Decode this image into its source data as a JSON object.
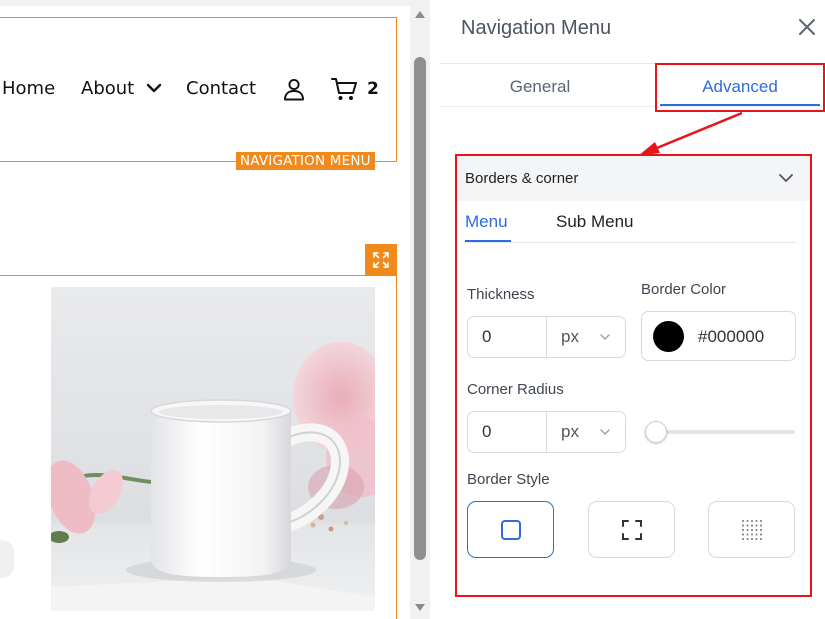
{
  "canvas": {
    "nav": {
      "items": [
        "Home",
        "About",
        "Contact"
      ],
      "cart_count": "2",
      "badge": "NAVIGATION MENU"
    },
    "icons": [
      "chevron-down-icon",
      "user-icon",
      "cart-icon",
      "expand-icon"
    ]
  },
  "panel": {
    "title": "Navigation Menu",
    "tabs": [
      {
        "label": "General",
        "active": false
      },
      {
        "label": "Advanced",
        "active": true
      }
    ],
    "section": {
      "title": "Borders & corner",
      "subtabs": [
        {
          "label": "Menu",
          "active": true
        },
        {
          "label": "Sub Menu",
          "active": false
        }
      ],
      "thickness": {
        "label": "Thickness",
        "value": "0",
        "unit": "px"
      },
      "border_color": {
        "label": "Border Color",
        "value": "#000000"
      },
      "corner_radius": {
        "label": "Corner Radius",
        "value": "0",
        "unit": "px",
        "slider_fraction": 0
      },
      "border_style": {
        "label": "Border Style",
        "options": [
          "solid",
          "corners",
          "dotted"
        ],
        "selected": "solid"
      }
    }
  },
  "colors": {
    "accent": "#2d6cdf",
    "canvas_highlight": "#f08a1c",
    "annotation": "#e8141c"
  }
}
